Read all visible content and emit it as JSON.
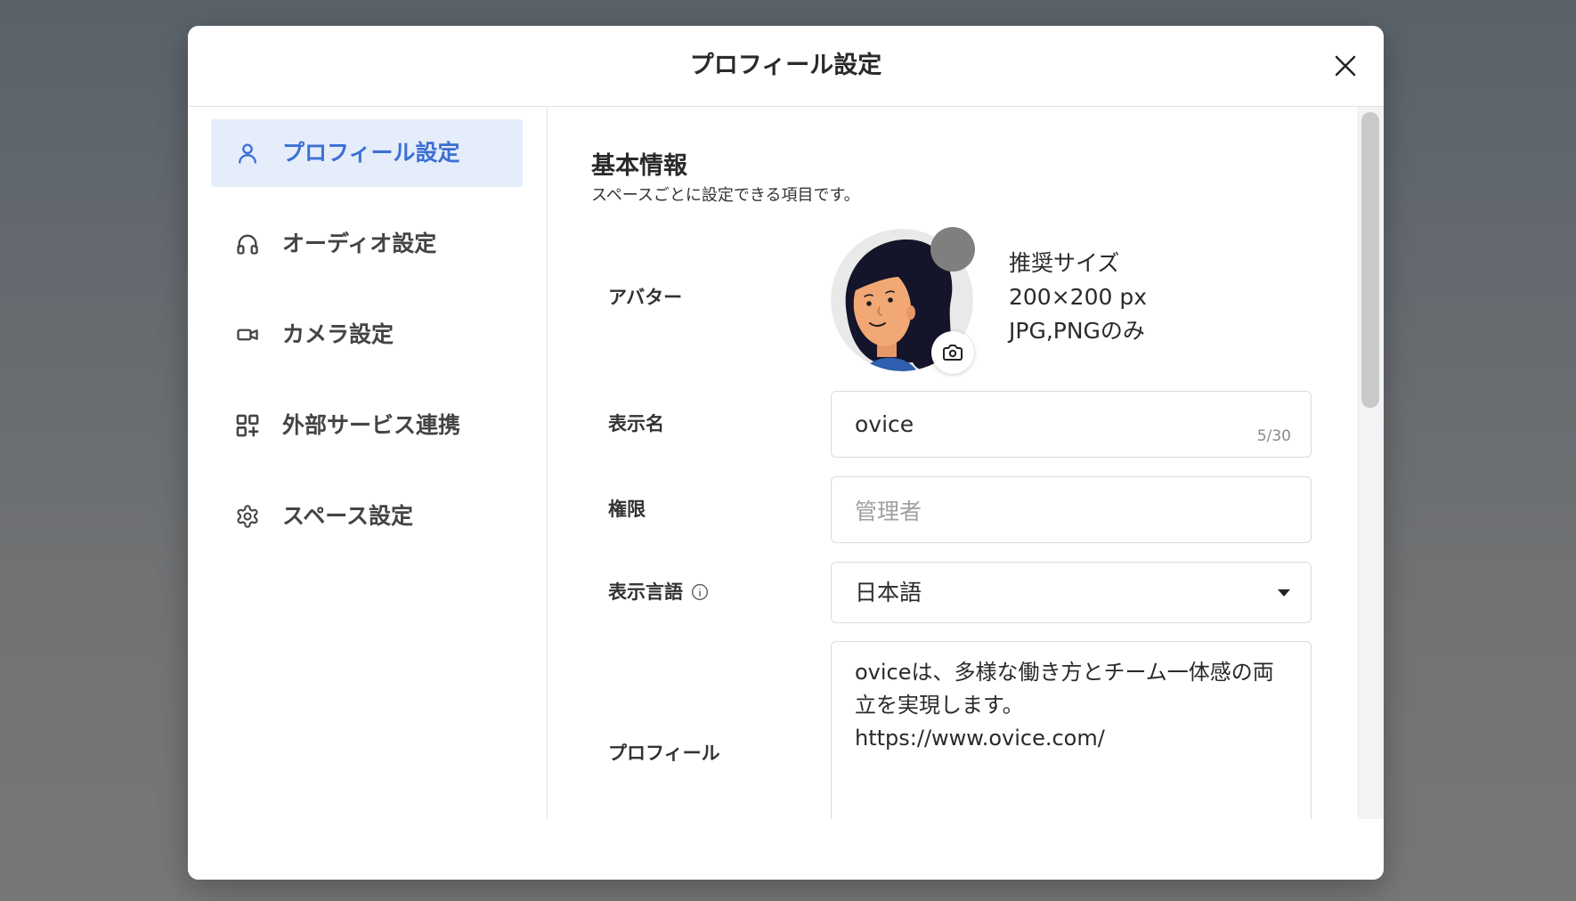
{
  "modal": {
    "title": "プロフィール設定",
    "close_icon": "close-icon"
  },
  "sidebar": {
    "items": [
      {
        "label": "プロフィール設定",
        "icon": "person-icon",
        "active": true
      },
      {
        "label": "オーディオ設定",
        "icon": "headphones-icon",
        "active": false
      },
      {
        "label": "カメラ設定",
        "icon": "video-camera-icon",
        "active": false
      },
      {
        "label": "外部サービス連携",
        "icon": "apps-add-icon",
        "active": false
      },
      {
        "label": "スペース設定",
        "icon": "gear-icon",
        "active": false
      }
    ]
  },
  "section": {
    "title": "基本情報",
    "subtitle": "スペースごとに設定できる項目です。"
  },
  "avatar": {
    "label": "アバター",
    "upload_icon": "camera-icon",
    "hint_lines": [
      "推奨サイズ",
      "200×200 px",
      "JPG,PNGのみ"
    ]
  },
  "display_name": {
    "label": "表示名",
    "value": "ovice",
    "counter": "5/30"
  },
  "role": {
    "label": "権限",
    "value": "管理者"
  },
  "language": {
    "label": "表示言語",
    "info_icon": "info-icon",
    "selected": "日本語"
  },
  "profile": {
    "label": "プロフィール",
    "lines": [
      "oviceは、多様な働き方とチーム一体感の両",
      "立を実現します。",
      "https://www.ovice.com/"
    ]
  },
  "colors": {
    "accent": "#3b6fd4",
    "active-bg": "#e5edfb",
    "border": "#dcdcdc"
  }
}
